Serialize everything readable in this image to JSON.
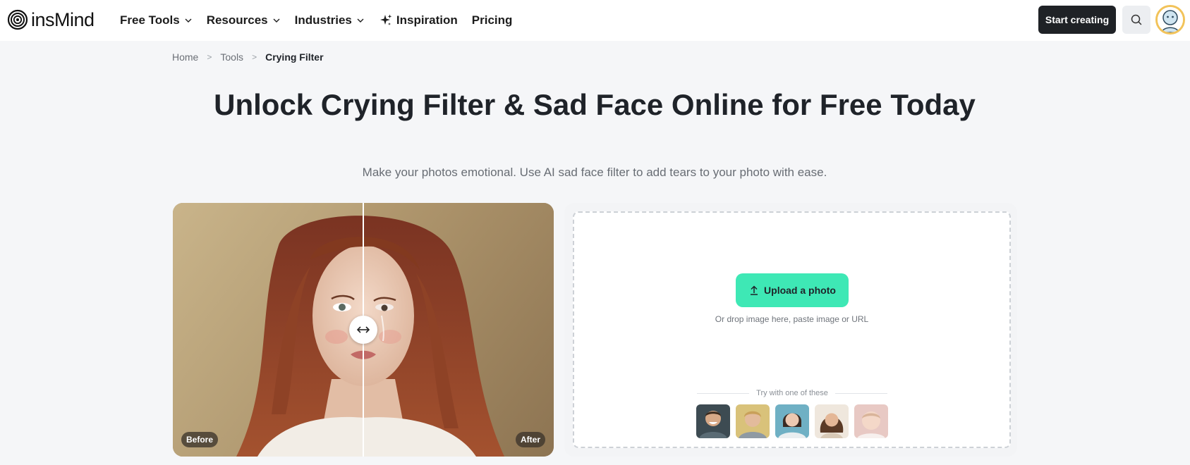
{
  "header": {
    "logo_text": "insMind",
    "nav": [
      {
        "label": "Free Tools",
        "has_dropdown": true
      },
      {
        "label": "Resources",
        "has_dropdown": true
      },
      {
        "label": "Industries",
        "has_dropdown": true
      },
      {
        "label": "Inspiration",
        "icon": "sparkle-icon"
      },
      {
        "label": "Pricing"
      }
    ],
    "start_label": "Start creating",
    "search_icon": "search-icon",
    "avatar_icon": "avatar"
  },
  "breadcrumb": {
    "items": [
      "Home",
      "Tools",
      "Crying Filter"
    ],
    "separator": ">"
  },
  "hero": {
    "title": "Unlock Crying Filter & Sad Face Online for Free Today",
    "subtitle": "Make your photos emotional. Use AI sad face filter to add tears to your photo with ease."
  },
  "compare": {
    "before_label": "Before",
    "after_label": "After",
    "handle_icon": "arrows-horizontal-icon"
  },
  "upload": {
    "button_label": "Upload a photo",
    "button_icon": "upload-icon",
    "hint": "Or drop image here, paste image or URL",
    "try_label": "Try with one of these",
    "samples": [
      "sample-man-smiling",
      "sample-man-blond",
      "sample-woman-short-hair",
      "sample-woman-curly",
      "sample-baby"
    ]
  },
  "colors": {
    "accent": "#3ee8b5",
    "dark_button": "#1f2226",
    "page_bg": "#f5f6f8",
    "avatar_ring": "#f2c35a"
  }
}
